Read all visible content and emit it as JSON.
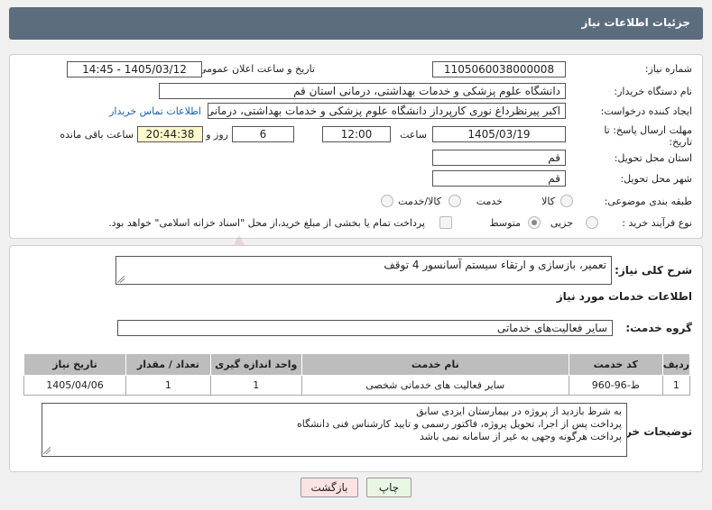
{
  "header": {
    "title": "جزئیات اطلاعات نیاز"
  },
  "form": {
    "need_number_label": "شماره نیاز:",
    "need_number": "1105060038000008",
    "announce_label": "تاریخ و ساعت اعلان عمومی:",
    "announce_value": "1405/03/12 - 14:45",
    "buyer_label": "نام دستگاه خریدار:",
    "buyer_value": "دانشگاه علوم پزشکی و خدمات بهداشتی، درمانی استان قم",
    "creator_label": "ایجاد کننده درخواست:",
    "creator_value": "اکبر پیرنظرداغ نوری کارپرداز دانشگاه علوم پزشکی و خدمات بهداشتی، درمانی استان قم",
    "contact_link": "اطلاعات تماس خریدار",
    "deadline_label": "مهلت ارسال پاسخ: تا تاریخ:",
    "deadline_date": "1405/03/19",
    "time_label": "ساعت",
    "deadline_time": "12:00",
    "days_value": "6",
    "days_label": "روز و",
    "remaining_value": "20:44:38",
    "remaining_label": "ساعت باقی مانده",
    "province_label": "استان محل تحویل:",
    "province_value": "قم",
    "city_label": "شهر محل تحویل:",
    "city_value": "قم",
    "category_label": "طبقه بندی موضوعی:",
    "category_options": [
      "کالا",
      "خدمت",
      "کالا/خدمت"
    ],
    "process_label": "نوع فرآیند خرید :",
    "process_options": [
      "جزیی",
      "متوسط"
    ],
    "payment_note": "پرداخت تمام یا بخشی از مبلغ خرید،از محل \"اسناد خزانه اسلامی\" خواهد بود."
  },
  "details": {
    "summary_label": "شرح کلی نیاز:",
    "summary_value": "تعمیر، بازسازی و ارتقاء سیستم آسانسور 4 توقف",
    "services_title": "اطلاعات خدمات مورد نیاز",
    "group_label": "گروه خدمت:",
    "group_value": "سایر فعالیت‌های خدماتی",
    "table": {
      "headers": [
        "ردیف",
        "کد خدمت",
        "نام خدمت",
        "واحد اندازه گیری",
        "تعداد / مقدار",
        "تاریخ نیاز"
      ],
      "rows": [
        [
          "1",
          "ط-96-960",
          "سایر فعالیت های خدماتی شخصی",
          "1",
          "1",
          "1405/04/06"
        ]
      ]
    },
    "buyer_notes_label": "توضیحات خریدار:",
    "buyer_notes": [
      "به شرط بازدید از پروژه در بیمارستان ایزدی سابق",
      "پرداخت پس از اجرا، تحویل پروژه، فاکتور رسمی و تایید کارشناس فنی دانشگاه",
      "پرداخت هرگونه وجهی به غیر از سامانه نمی باشد"
    ]
  },
  "buttons": {
    "print": "چاپ",
    "back": "بازگشت"
  },
  "watermark_text": "AriaTender.net"
}
